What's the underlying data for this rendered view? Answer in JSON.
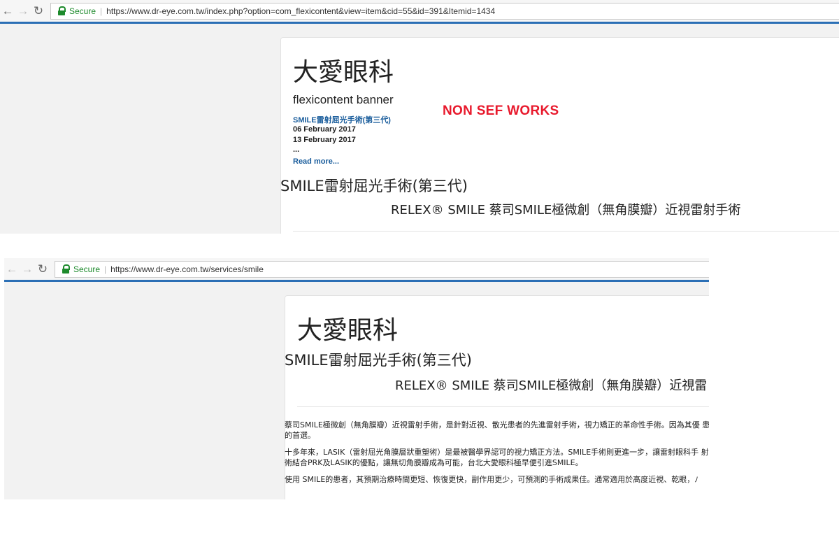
{
  "shot1": {
    "url": "https://www.dr-eye.com.tw/index.php?option=com_flexicontent&view=item&cid=55&id=391&Itemid=1434",
    "secure_label": "Secure",
    "site_title": "大愛眼科",
    "banner": {
      "heading": "flexicontent banner",
      "link": "SMILE雷射屈光手術(第三代)",
      "date1": "06 February 2017",
      "date2": "13 February 2017",
      "ellipsis": "...",
      "read_more": "Read more..."
    },
    "annotation": "NON SEF WORKS",
    "article_title": "SMILE雷射屈光手術(第三代)",
    "article_subtitle": "RELEX® SMILE 蔡司SMILE極微創（無角膜瓣）近視雷射手術"
  },
  "shot2": {
    "url": "https://www.dr-eye.com.tw/services/smile",
    "secure_label": "Secure",
    "site_title": "大愛眼科",
    "article_title": "SMILE雷射屈光手術(第三代)",
    "article_subtitle": "RELEX® SMILE 蔡司SMILE極微創（無角膜瓣）近視雷",
    "paragraphs": [
      "蔡司SMILE極微創（無角膜瓣）近視雷射手術，是針對近視、散光患者的先進雷射手術，視力矯正的革命性手術。因為其優 患者的首選。",
      "十多年來，LASIK（雷射屈光角膜層狀重塑術）是最被醫學界認可的視力矯正方法。SMILE手術則更進一步，讓雷射眼科手 射手術結合PRK及LASIK的優點，讓無切角膜瓣成為可能，台北大愛眼科極早便引進SMILE。",
      "使用 SMILE的患者，其預期治療時間更短、恢復更快，副作用更少，可預測的手術成果佳。通常適用於高度近視、乾眼，ﾉ"
    ]
  }
}
